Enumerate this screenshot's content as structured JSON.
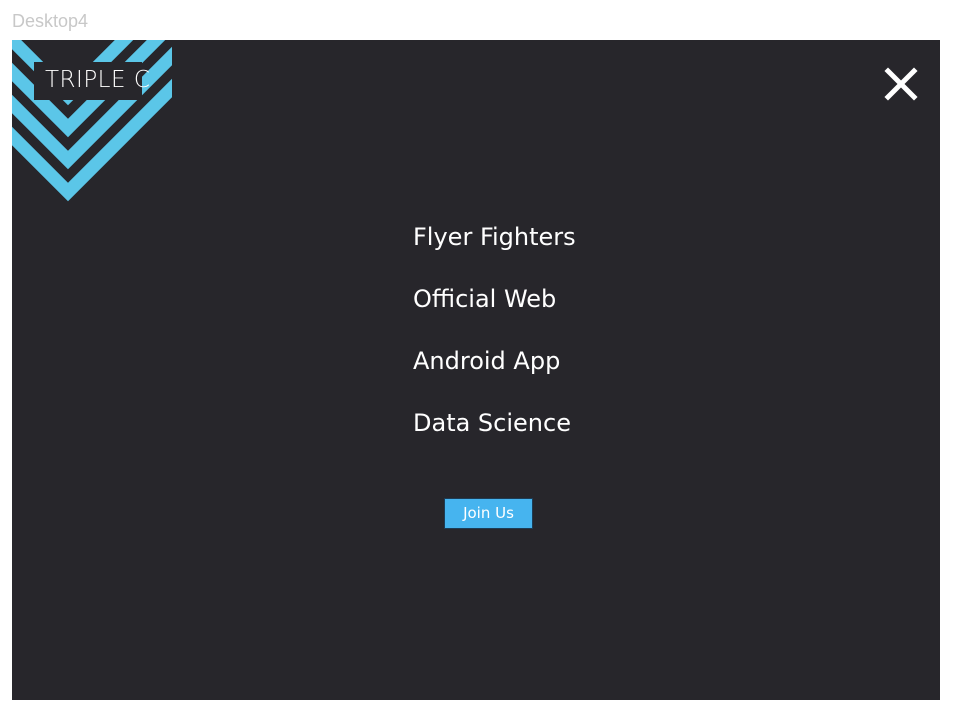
{
  "frame": {
    "label": "Desktop4"
  },
  "brand": {
    "name": "TRIPLE C",
    "logo_icon": "chevron-diamond-logo",
    "accent_color": "#5bc6e8"
  },
  "header": {
    "close_icon": "close-icon"
  },
  "nav": {
    "items": [
      {
        "label": "Flyer Fighters"
      },
      {
        "label": "Official Web"
      },
      {
        "label": "Android App"
      },
      {
        "label": "Data Science"
      }
    ]
  },
  "cta": {
    "join_label": "Join Us",
    "color": "#46b4ef"
  },
  "theme": {
    "background": "#27262b",
    "text": "#ffffff"
  }
}
